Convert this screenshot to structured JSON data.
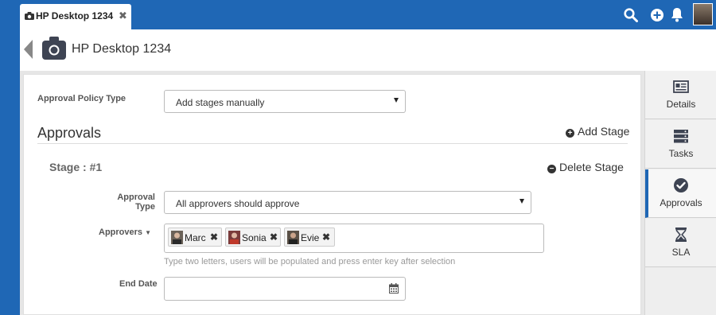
{
  "tab": {
    "title": "HP Desktop 1234",
    "icon": "camera-icon",
    "close_glyph": "✖"
  },
  "topbar": {
    "icons": [
      "search-icon",
      "plus-circle-icon",
      "bell-icon",
      "user-avatar"
    ]
  },
  "header": {
    "title": "HP Desktop 1234",
    "icon": "camera-icon"
  },
  "form": {
    "policy_type_label": "Approval Policy Type",
    "policy_type_value": "Add stages manually",
    "approvals_heading": "Approvals",
    "add_stage_label": "Add Stage",
    "stage_title": "Stage : #1",
    "delete_stage_label": "Delete Stage",
    "approval_type_label": "Approval Type",
    "approval_type_value": "All approvers should approve",
    "approvers_label": "Approvers",
    "approvers_caret": "▼",
    "approvers": [
      {
        "name": "Marc",
        "remove": "✖"
      },
      {
        "name": "Sonia",
        "remove": "✖"
      },
      {
        "name": "Evie",
        "remove": "✖"
      }
    ],
    "approvers_hint": "Type two letters, users will be populated and press enter key after selection",
    "end_date_label": "End Date",
    "end_date_value": ""
  },
  "sidebar": {
    "items": [
      {
        "label": "Details",
        "icon": "newspaper-icon"
      },
      {
        "label": "Tasks",
        "icon": "server-icon"
      },
      {
        "label": "Approvals",
        "icon": "check-circle-icon"
      },
      {
        "label": "SLA",
        "icon": "hourglass-icon"
      }
    ],
    "active": "Approvals"
  },
  "colors": {
    "brand": "#1f67b5",
    "chip_bg": "#f3f3f3"
  }
}
